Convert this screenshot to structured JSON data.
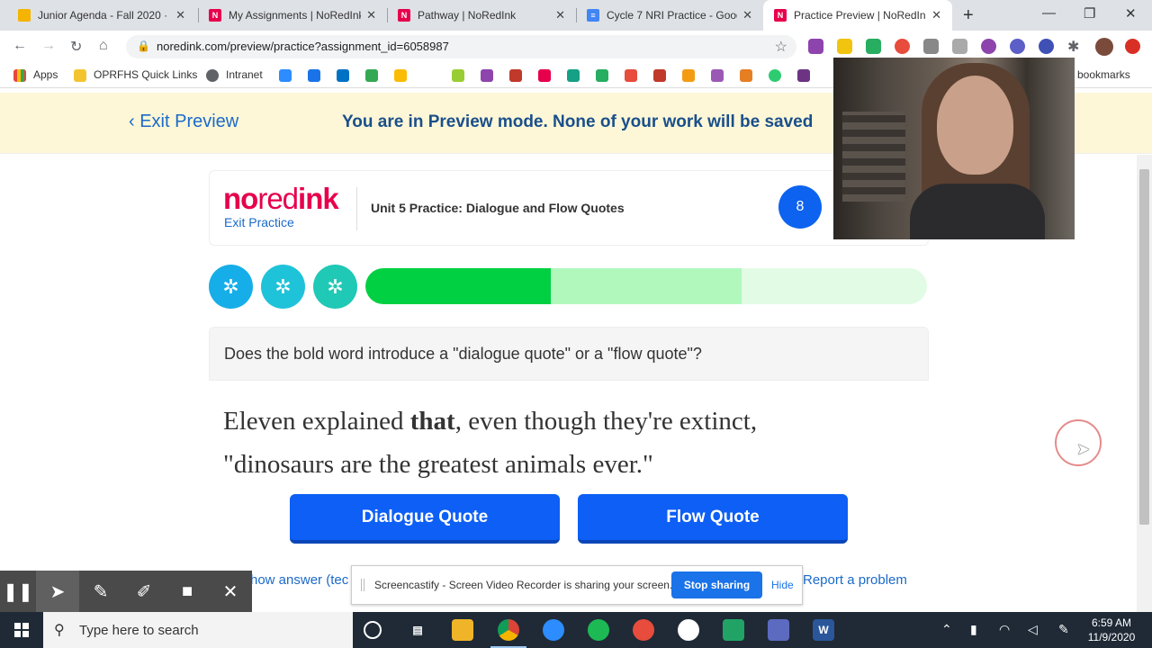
{
  "browser": {
    "tabs": [
      {
        "title": "Junior Agenda - Fall 2020 ·",
        "fav_color": "#f4b400"
      },
      {
        "title": "My Assignments | NoRedInk",
        "fav_color": "#e7004c"
      },
      {
        "title": "Pathway | NoRedInk",
        "fav_color": "#e7004c"
      },
      {
        "title": "Cycle 7 NRI Practice - Goog",
        "fav_color": "#4285f4"
      },
      {
        "title": "Practice Preview | NoRedInk",
        "fav_color": "#e7004c",
        "active": true
      }
    ],
    "url": "noredink.com/preview/practice?assignment_id=6058987",
    "bookmarks": {
      "apps": "Apps",
      "quick_links": "OPRFHS Quick Links",
      "intranet": "Intranet",
      "other": "er bookmarks"
    }
  },
  "banner": {
    "exit_preview": "Exit Preview",
    "message": "You are in Preview mode. None of your work will be saved"
  },
  "practice": {
    "logo_no": "no",
    "logo_red": "red",
    "logo_ink": "ink",
    "exit_practice": "Exit Practice",
    "unit_title": "Unit 5 Practice: Dialogue and Flow Quotes",
    "count": "8",
    "progress": {
      "completed": 0.33,
      "in_progress": 0.67
    },
    "prompt": "Does the bold word introduce a \"dialogue quote\" or a \"flow quote\"?",
    "sentence_before": "Eleven explained ",
    "sentence_bold": "that",
    "sentence_after": ", even though they're extinct, \"dinosaurs are the greatest animals ever.\"",
    "answers": [
      "Dialogue Quote",
      "Flow Quote"
    ],
    "show_answer": "how answer (tec",
    "report": "Report a problem"
  },
  "screencastify": {
    "message": "Screencastify - Screen Video Recorder is sharing your screen.",
    "stop": "Stop sharing",
    "hide": "Hide"
  },
  "taskbar": {
    "search_placeholder": "Type here to search",
    "time": "6:59 AM",
    "date": "11/9/2020"
  }
}
